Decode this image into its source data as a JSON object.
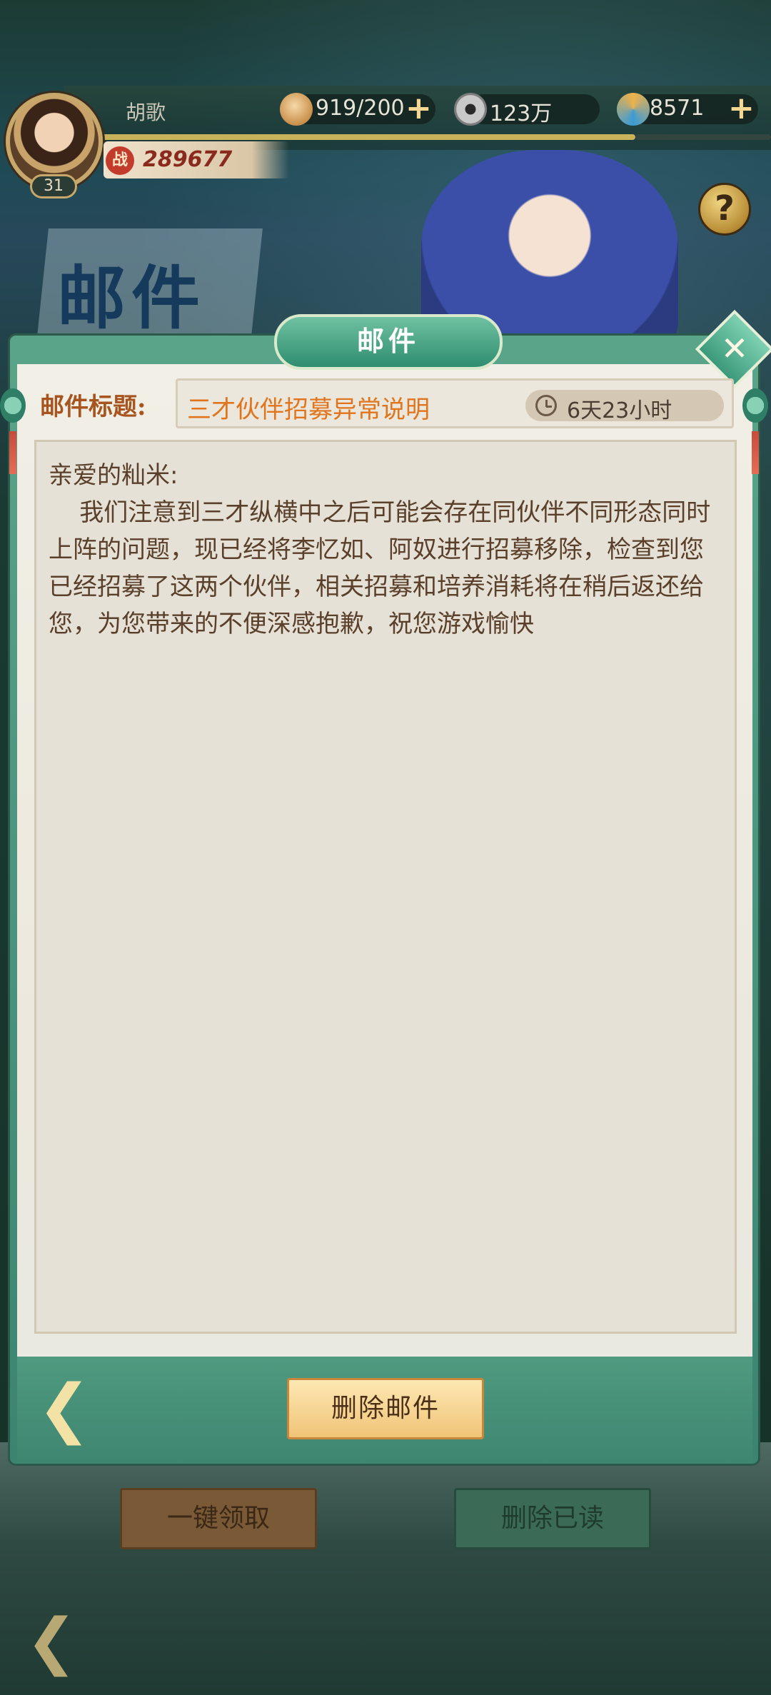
{
  "hud": {
    "player_name": "胡歌",
    "level": "31",
    "power": "289677",
    "power_icon_text": "战",
    "stamina": "919/200",
    "coins": "123万",
    "gems": "8571"
  },
  "banner": {
    "title": "邮件"
  },
  "mail_panel": {
    "title": "邮件",
    "subject_label": "邮件标题:",
    "subject": "三才伙伴招募异常说明",
    "time_left": "6天23小时",
    "body": "亲爱的籼米:\n    我们注意到三才纵横中之后可能会存在同伙伴不同形态同时上阵的问题，现已经将李忆如、阿奴进行招募移除，检查到您已经招募了这两个伙伴，相关招募和培养消耗将在稍后返还给您，为您带来的不便深感抱歉，祝您游戏愉快",
    "delete_button": "删除邮件",
    "close_icon": "close-icon",
    "back_icon": "back-arrow-icon"
  },
  "mail_list": {
    "claim_all_button": "一键领取",
    "delete_read_button": "删除已读"
  },
  "icons": {
    "help": "?",
    "plus": "+"
  },
  "colors": {
    "panel_green": "#3c8470",
    "subject_orange": "#e0751d",
    "body_text": "#5a3f2a"
  }
}
